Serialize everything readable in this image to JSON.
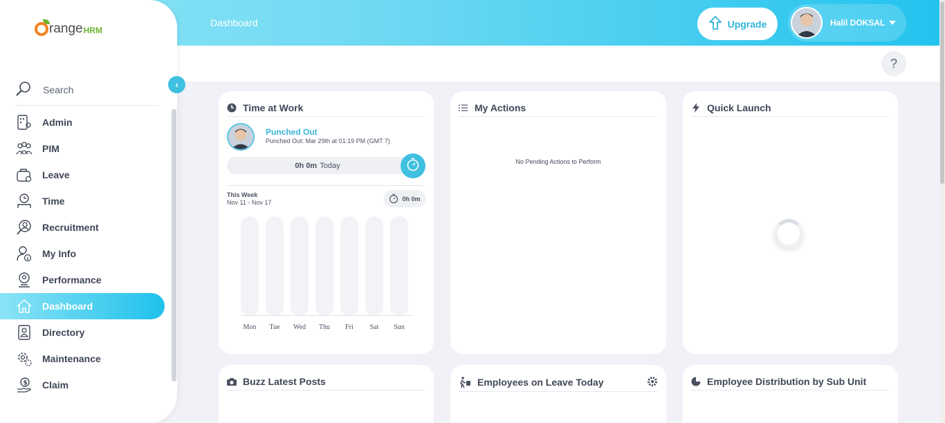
{
  "header": {
    "title": "Dashboard",
    "upgrade_label": "Upgrade",
    "user_name": "Halil DOKSAL",
    "help_label": "?"
  },
  "sidebar": {
    "logo": {
      "text": "range",
      "brand": "HRM"
    },
    "search_label": "Search",
    "items": [
      {
        "label": "Admin",
        "icon": "admin-icon"
      },
      {
        "label": "PIM",
        "icon": "pim-icon"
      },
      {
        "label": "Leave",
        "icon": "leave-icon"
      },
      {
        "label": "Time",
        "icon": "time-icon"
      },
      {
        "label": "Recruitment",
        "icon": "recruitment-icon"
      },
      {
        "label": "My Info",
        "icon": "my-info-icon"
      },
      {
        "label": "Performance",
        "icon": "performance-icon"
      },
      {
        "label": "Dashboard",
        "icon": "home-icon",
        "active": true
      },
      {
        "label": "Directory",
        "icon": "directory-icon"
      },
      {
        "label": "Maintenance",
        "icon": "maintenance-icon"
      },
      {
        "label": "Claim",
        "icon": "claim-icon"
      }
    ]
  },
  "time_at_work": {
    "title": "Time at Work",
    "status": "Punched Out",
    "status_detail": "Punched Out: Mar 29th at 01:19 PM (GMT 7)",
    "today_value": "0h 0m",
    "today_label": "Today",
    "week_label": "This Week",
    "week_range": "Nov 11 - Nov 17",
    "week_total": "0h 0m",
    "days": [
      "Mon",
      "Tue",
      "Wed",
      "Thu",
      "Fri",
      "Sat",
      "Sun"
    ]
  },
  "my_actions": {
    "title": "My Actions",
    "empty_text": "No Pending Actions to Perform"
  },
  "quick_launch": {
    "title": "Quick Launch"
  },
  "buzz": {
    "title": "Buzz Latest Posts"
  },
  "leave_today": {
    "title": "Employees on Leave Today"
  },
  "distribution": {
    "title": "Employee Distribution by Sub Unit"
  },
  "colors": {
    "accent": "#3fc0e0",
    "text": "#3e4656",
    "header_start": "#8ee6f6",
    "header_end": "#23c3ee"
  }
}
